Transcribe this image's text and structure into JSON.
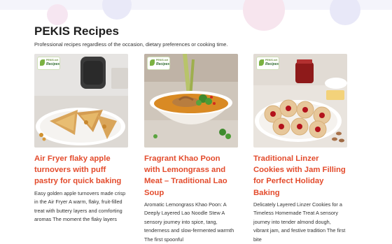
{
  "header": {
    "title": "PEKIS Recipes",
    "subtitle": "Professional recipes regardless of the occasion, dietary preferences or cooking time."
  },
  "logo": {
    "brand": "PEKIS.net",
    "word": "Recipes"
  },
  "colors": {
    "title_accent": "#e34b2c",
    "background": "#ffffff"
  },
  "cards": [
    {
      "title": "Air Fryer flaky apple turnovers with puff pastry for quick baking",
      "excerpt": "Easy golden apple turnovers made crisp in the Air Fryer A warm, flaky, fruit-filled treat with buttery layers and comforting aromas The moment the flaky layers"
    },
    {
      "title": "Fragrant Khao Poon with Lemongrass and Meat – Traditional Lao Soup",
      "excerpt": "Aromatic Lemongrass Khao Poon: A Deeply Layered Lao Noodle Stew A sensory journey into spice, tang, tenderness and slow-fermented warmth The first spoonful"
    },
    {
      "title": "Traditional Linzer Cookies with Jam Filling for Perfect Holiday Baking",
      "excerpt": "Delicately Layered Linzer Cookies for a Timeless Homemade Treat A sensory journey into tender almond dough, vibrant jam, and festive tradition The first bite"
    }
  ]
}
